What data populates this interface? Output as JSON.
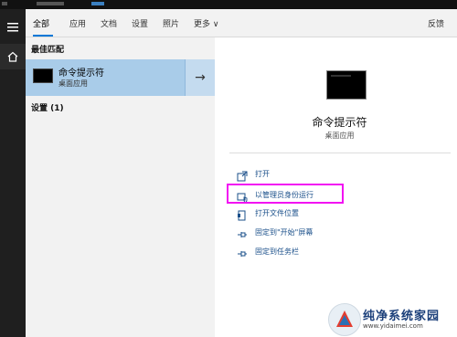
{
  "tabs": [
    {
      "label": "全部"
    },
    {
      "label": "应用"
    },
    {
      "label": "文档"
    },
    {
      "label": "设置"
    },
    {
      "label": "照片"
    },
    {
      "label": "更多"
    }
  ],
  "more_chevron": "∨",
  "feedback_label": "反馈",
  "rail": {
    "menu_icon": "hamburger-icon",
    "home_icon": "home-icon"
  },
  "left": {
    "best_match_title": "最佳匹配",
    "result": {
      "name": "命令提示符",
      "subtitle": "桌面应用",
      "arrow": "→"
    },
    "settings_title": "设置 (1)"
  },
  "right": {
    "app_title": "命令提示符",
    "app_subtitle": "桌面应用",
    "actions": [
      {
        "label": "打开",
        "icon": "open-icon"
      },
      {
        "label": "以管理员身份运行",
        "icon": "shield-run-icon"
      },
      {
        "label": "打开文件位置",
        "icon": "file-location-icon"
      },
      {
        "label": "固定到\"开始\"屏幕",
        "icon": "pin-icon"
      },
      {
        "label": "固定到任务栏",
        "icon": "pin-icon"
      }
    ]
  },
  "watermark": {
    "brand": "纯净系统家园",
    "url": "www.yidaimei.com"
  },
  "colors": {
    "accent": "#0078d7",
    "selected_result": "#a9cce9",
    "highlight_box": "#f211f2",
    "action_text": "#1a4f8a"
  }
}
